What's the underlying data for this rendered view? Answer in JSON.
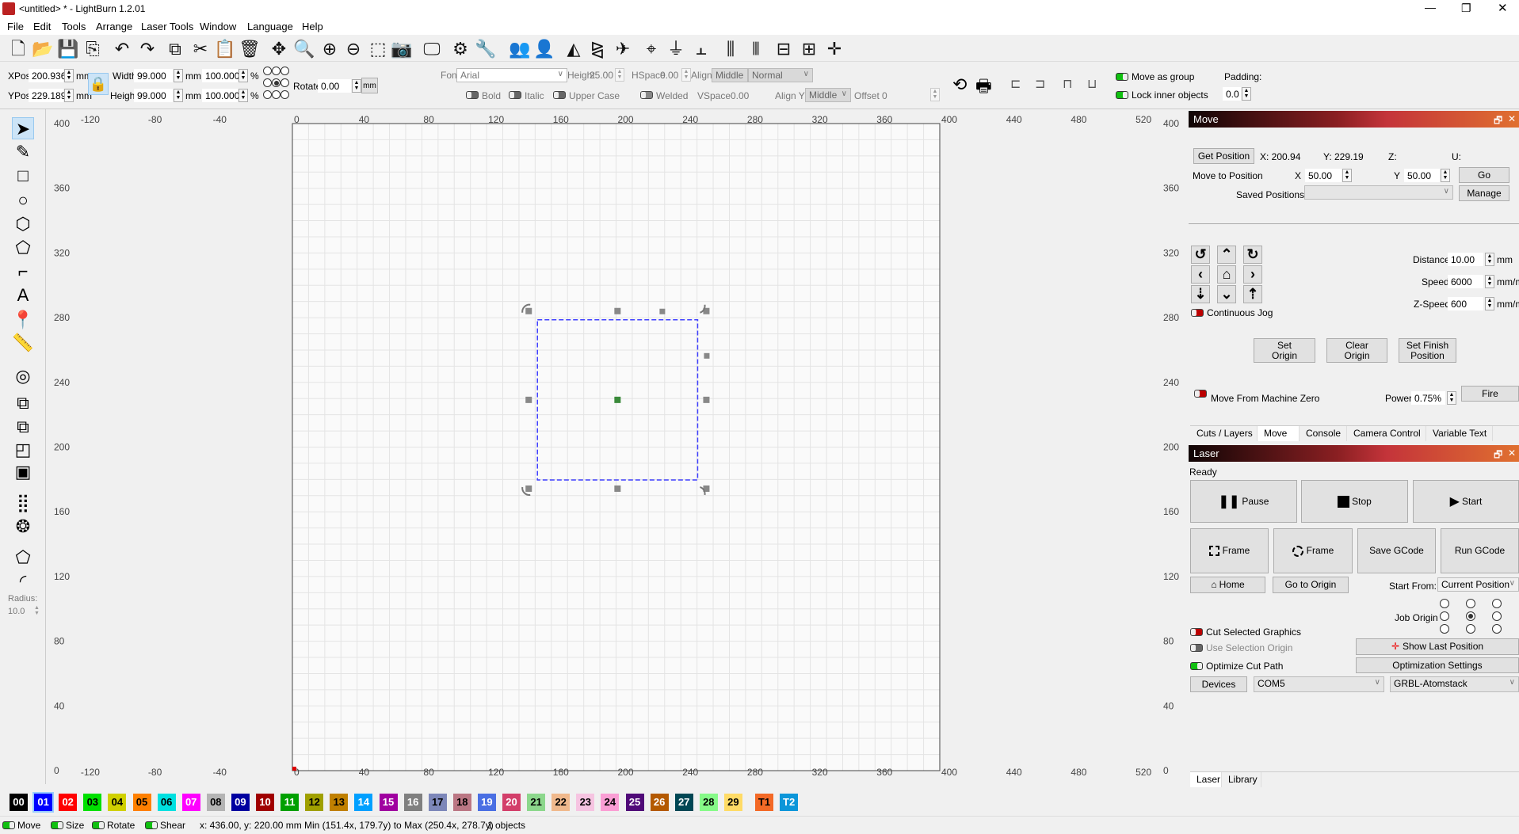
{
  "window": {
    "title": "<untitled> * - LightBurn 1.2.01",
    "controls": [
      "minimize-icon",
      "restore-icon",
      "close-icon"
    ]
  },
  "menu": [
    "File",
    "Edit",
    "Tools",
    "Arrange",
    "Laser Tools",
    "Window",
    "Language",
    "Help"
  ],
  "toolbar": [
    {
      "icon": "new-file-icon",
      "glyph": "🗋"
    },
    {
      "icon": "open-folder-icon",
      "glyph": "📂"
    },
    {
      "icon": "save-icon",
      "glyph": "💾"
    },
    {
      "icon": "import-icon",
      "glyph": "⎘"
    },
    {
      "icon": "undo-icon",
      "glyph": "↶"
    },
    {
      "icon": "redo-icon",
      "glyph": "↷"
    },
    {
      "icon": "copy-icon",
      "glyph": "⧉"
    },
    {
      "icon": "cut-icon",
      "glyph": "✂"
    },
    {
      "icon": "paste-icon",
      "glyph": "📋"
    },
    {
      "icon": "delete-icon",
      "glyph": "🗑"
    },
    {
      "icon": "move-icon",
      "glyph": "✥"
    },
    {
      "icon": "zoom-page-icon",
      "glyph": "🔍"
    },
    {
      "icon": "zoom-in-icon",
      "glyph": "⊕"
    },
    {
      "icon": "zoom-out-icon",
      "glyph": "⊖"
    },
    {
      "icon": "zoom-selection-icon",
      "glyph": "⬚"
    },
    {
      "icon": "camera-icon",
      "glyph": "📷"
    },
    {
      "icon": "monitor-icon",
      "glyph": "🖵"
    },
    {
      "icon": "settings-icon",
      "glyph": "⚙"
    },
    {
      "icon": "machine-settings-icon",
      "glyph": "🔧"
    },
    {
      "icon": "group-icon",
      "glyph": "👥"
    },
    {
      "icon": "ungroup-icon",
      "glyph": "👤"
    },
    {
      "icon": "flip-horizontal-icon",
      "glyph": "◭"
    },
    {
      "icon": "mirror-icon",
      "glyph": "⧎"
    },
    {
      "icon": "send-icon",
      "glyph": "✈"
    },
    {
      "icon": "align-center-icon",
      "glyph": "⌖"
    },
    {
      "icon": "align-vcenter-icon",
      "glyph": "⏚"
    },
    {
      "icon": "align-hcenter-icon",
      "glyph": "⫠"
    },
    {
      "icon": "distribute-h-icon",
      "glyph": "⫼"
    },
    {
      "icon": "distribute-v-icon",
      "glyph": "⫴"
    },
    {
      "icon": "make-same-width-icon",
      "glyph": "⊟"
    },
    {
      "icon": "make-same-height-icon",
      "glyph": "⊞"
    },
    {
      "icon": "dock-icon",
      "glyph": "✛"
    }
  ],
  "props": {
    "xpos_label": "XPos",
    "xpos": "200.936",
    "ypos_label": "YPos",
    "ypos": "229.189",
    "unit": "mm",
    "width_label": "Width",
    "width": "99.000",
    "height_label": "Height",
    "height": "99.000",
    "width_pct": "100.000",
    "height_pct": "100.000",
    "pct": "%",
    "rotate_label": "Rotate",
    "rotate": "0.00",
    "mm_button": "mm",
    "font_label": "Font",
    "font": "Arial",
    "text_height_label": "Height",
    "text_height": "25.00",
    "hspace_label": "HSpace",
    "hspace": "0.00",
    "vspace_label": "VSpace",
    "vspace": "0.00",
    "alignx_label": "Align X",
    "alignx": "Middle",
    "aligny_label": "Align Y",
    "aligny": "Middle",
    "style": "Normal",
    "offset_label": "Offset",
    "offset": "0",
    "bold": "Bold",
    "italic": "Italic",
    "upper": "Upper Case",
    "welded": "Welded",
    "move_group": "Move as group",
    "lock_inner": "Lock inner objects",
    "padding_label": "Padding:",
    "padding": "0.0"
  },
  "left_tools": [
    "select-icon",
    "draw-lines-icon",
    "rectangle-icon",
    "ellipse-icon",
    "polygon-icon",
    "edit-nodes-icon",
    "frame-icon",
    "text-icon",
    "position-marker-icon",
    "measure-icon",
    "offset-icon",
    "weld-icon",
    "boolean-union-icon",
    "boolean-subtract-icon",
    "boolean-intersect-icon",
    "grid-array-icon",
    "circular-array-icon",
    "tabs-icon",
    "corner-radius-icon"
  ],
  "radius": {
    "label": "Radius:",
    "value": "10.0"
  },
  "rulers": {
    "x_labels": [
      -120,
      -80,
      -40,
      0,
      40,
      80,
      120,
      160,
      200,
      240,
      280,
      320,
      360,
      400,
      440,
      480,
      520
    ],
    "y_labels": [
      0,
      40,
      80,
      120,
      160,
      200,
      240,
      280,
      320,
      360,
      400
    ]
  },
  "selection": {
    "min_x": 151.4,
    "min_y": 179.7,
    "max_x": 250.4,
    "max_y": 278.7,
    "color": "#4040ff"
  },
  "move_panel": {
    "title": "Move",
    "get_position": "Get Position",
    "x": "X: 200.94",
    "y": "Y: 229.19",
    "z": "Z:",
    "u": "U:",
    "move_to": "Move to Position",
    "x_label": "X",
    "x_value": "50.00",
    "y_label": "Y",
    "y_value": "50.00",
    "go": "Go",
    "saved_label": "Saved Positions:",
    "saved_value": "",
    "manage": "Manage",
    "distance_label": "Distance",
    "distance": "10.00",
    "distance_unit": "mm",
    "speed_label": "Speed",
    "speed": "6000",
    "speed_unit": "mm/m",
    "zspeed_label": "Z-Speed",
    "zspeed": "600",
    "zspeed_unit": "mm/m",
    "continuous_jog": "Continuous Jog",
    "set_origin": "Set\nOrigin",
    "clear_origin": "Clear\nOrigin",
    "set_finish": "Set Finish\nPosition",
    "machine_zero": "Move From Machine Zero",
    "power_label": "Power",
    "power": "0.75%",
    "fire": "Fire"
  },
  "tabs": [
    {
      "label": "Cuts / Layers"
    },
    {
      "label": "Move",
      "active": true
    },
    {
      "label": "Console"
    },
    {
      "label": "Camera Control"
    },
    {
      "label": "Variable Text"
    }
  ],
  "laser_panel": {
    "title": "Laser",
    "status": "Ready",
    "pause": "Pause",
    "stop": "Stop",
    "start": "Start",
    "frame1": "Frame",
    "frame2": "Frame",
    "save_gcode": "Save GCode",
    "run_gcode": "Run GCode",
    "home": "Home",
    "go_origin": "Go to Origin",
    "start_from_label": "Start From:",
    "start_from": "Current Position",
    "job_origin": "Job Origin",
    "job_origin_selected": 4,
    "cut_selected": "Cut Selected Graphics",
    "use_selection_origin": "Use Selection Origin",
    "optimize": "Optimize Cut Path",
    "show_last": "Show Last Position",
    "opt_settings": "Optimization Settings",
    "devices": "Devices",
    "port": "COM5",
    "device": "GRBL-Atomstack"
  },
  "bottom_tabs": [
    {
      "label": "Laser",
      "active": true
    },
    {
      "label": "Library"
    }
  ],
  "palette": [
    {
      "id": "00",
      "bg": "#000000",
      "fg": "#fff"
    },
    {
      "id": "01",
      "bg": "#0000ff",
      "fg": "#fff"
    },
    {
      "id": "02",
      "bg": "#ff0000",
      "fg": "#fff"
    },
    {
      "id": "03",
      "bg": "#00e000",
      "fg": "#000"
    },
    {
      "id": "04",
      "bg": "#d0d000",
      "fg": "#000"
    },
    {
      "id": "05",
      "bg": "#ff8000",
      "fg": "#000"
    },
    {
      "id": "06",
      "bg": "#00e0e0",
      "fg": "#000"
    },
    {
      "id": "07",
      "bg": "#ff00ff",
      "fg": "#fff"
    },
    {
      "id": "08",
      "bg": "#b4b4b4",
      "fg": "#000"
    },
    {
      "id": "09",
      "bg": "#0000a0",
      "fg": "#fff"
    },
    {
      "id": "10",
      "bg": "#a00000",
      "fg": "#fff"
    },
    {
      "id": "11",
      "bg": "#00a000",
      "fg": "#fff"
    },
    {
      "id": "12",
      "bg": "#a0a000",
      "fg": "#000"
    },
    {
      "id": "13",
      "bg": "#c08000",
      "fg": "#000"
    },
    {
      "id": "14",
      "bg": "#00a0ff",
      "fg": "#fff"
    },
    {
      "id": "15",
      "bg": "#a000a0",
      "fg": "#fff"
    },
    {
      "id": "16",
      "bg": "#808080",
      "fg": "#fff"
    },
    {
      "id": "17",
      "bg": "#7d87b9",
      "fg": "#000"
    },
    {
      "id": "18",
      "bg": "#bb7784",
      "fg": "#000"
    },
    {
      "id": "19",
      "bg": "#4a6fe3",
      "fg": "#fff"
    },
    {
      "id": "20",
      "bg": "#d33f6a",
      "fg": "#fff"
    },
    {
      "id": "21",
      "bg": "#8cd78c",
      "fg": "#000"
    },
    {
      "id": "22",
      "bg": "#f0b98d",
      "fg": "#000"
    },
    {
      "id": "23",
      "bg": "#f6c4e1",
      "fg": "#000"
    },
    {
      "id": "24",
      "bg": "#fa9ed4",
      "fg": "#000"
    },
    {
      "id": "25",
      "bg": "#500a78",
      "fg": "#fff"
    },
    {
      "id": "26",
      "bg": "#b45a00",
      "fg": "#fff"
    },
    {
      "id": "27",
      "bg": "#004754",
      "fg": "#fff"
    },
    {
      "id": "28",
      "bg": "#86fa88",
      "fg": "#000"
    },
    {
      "id": "29",
      "bg": "#ffdb66",
      "fg": "#000"
    },
    {
      "id": "T1",
      "bg": "#f36926",
      "fg": "#000"
    },
    {
      "id": "T2",
      "bg": "#0c96d9",
      "fg": "#fff"
    }
  ],
  "status": {
    "move": "Move",
    "size": "Size",
    "rotate": "Rotate",
    "shear": "Shear",
    "cursor": "x: 436.00, y: 220.00 mm",
    "bounds": "Min (151.4x, 179.7y) to Max (250.4x, 278.7y)",
    "objects": "1 objects"
  }
}
